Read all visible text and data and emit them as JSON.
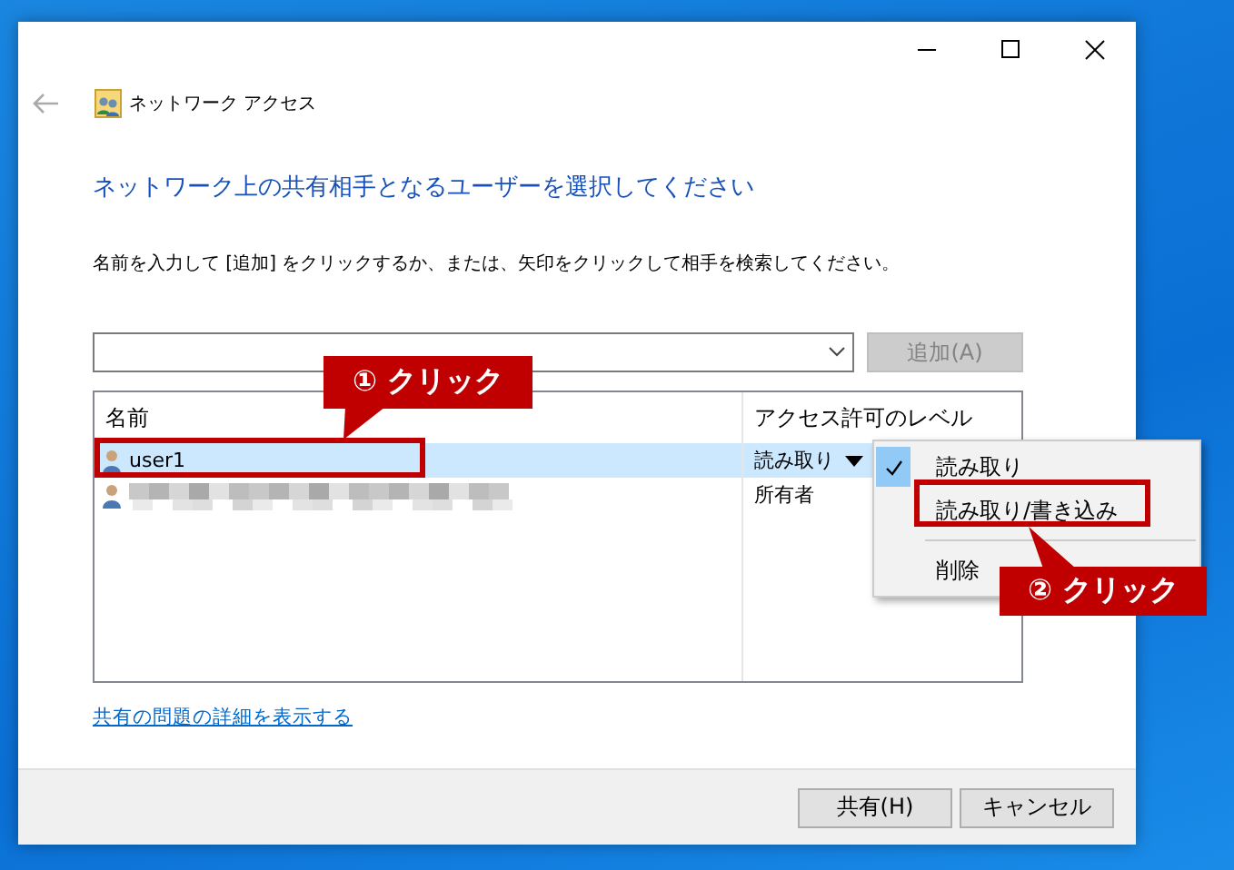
{
  "window": {
    "title": "ネットワーク アクセス"
  },
  "heading": "ネットワーク上の共有相手となるユーザーを選択してください",
  "instruction": "名前を入力して [追加] をクリックするか、または、矢印をクリックして相手を検索してください。",
  "add_button": {
    "label": "追加(A)",
    "disabled": true
  },
  "list": {
    "columns": [
      "名前",
      "アクセス許可のレベル"
    ],
    "rows": [
      {
        "name": "user1",
        "access": "読み取り",
        "selected": true,
        "name_blurred": false,
        "dropdown": true
      },
      {
        "access": "所有者",
        "selected": false,
        "name_blurred": true,
        "dropdown": false
      }
    ]
  },
  "menu": {
    "items": [
      {
        "kind": "option",
        "label": "読み取り",
        "checked": true
      },
      {
        "kind": "option",
        "label": "読み取り/書き込み",
        "checked": false
      },
      {
        "kind": "separator"
      },
      {
        "kind": "option",
        "label": "削除",
        "checked": false
      }
    ]
  },
  "link": "共有の問題の詳細を表示する",
  "buttons": [
    "共有(H)",
    "キャンセル"
  ],
  "annotations": [
    {
      "text": "① クリック"
    },
    {
      "text": "② クリック"
    }
  ]
}
